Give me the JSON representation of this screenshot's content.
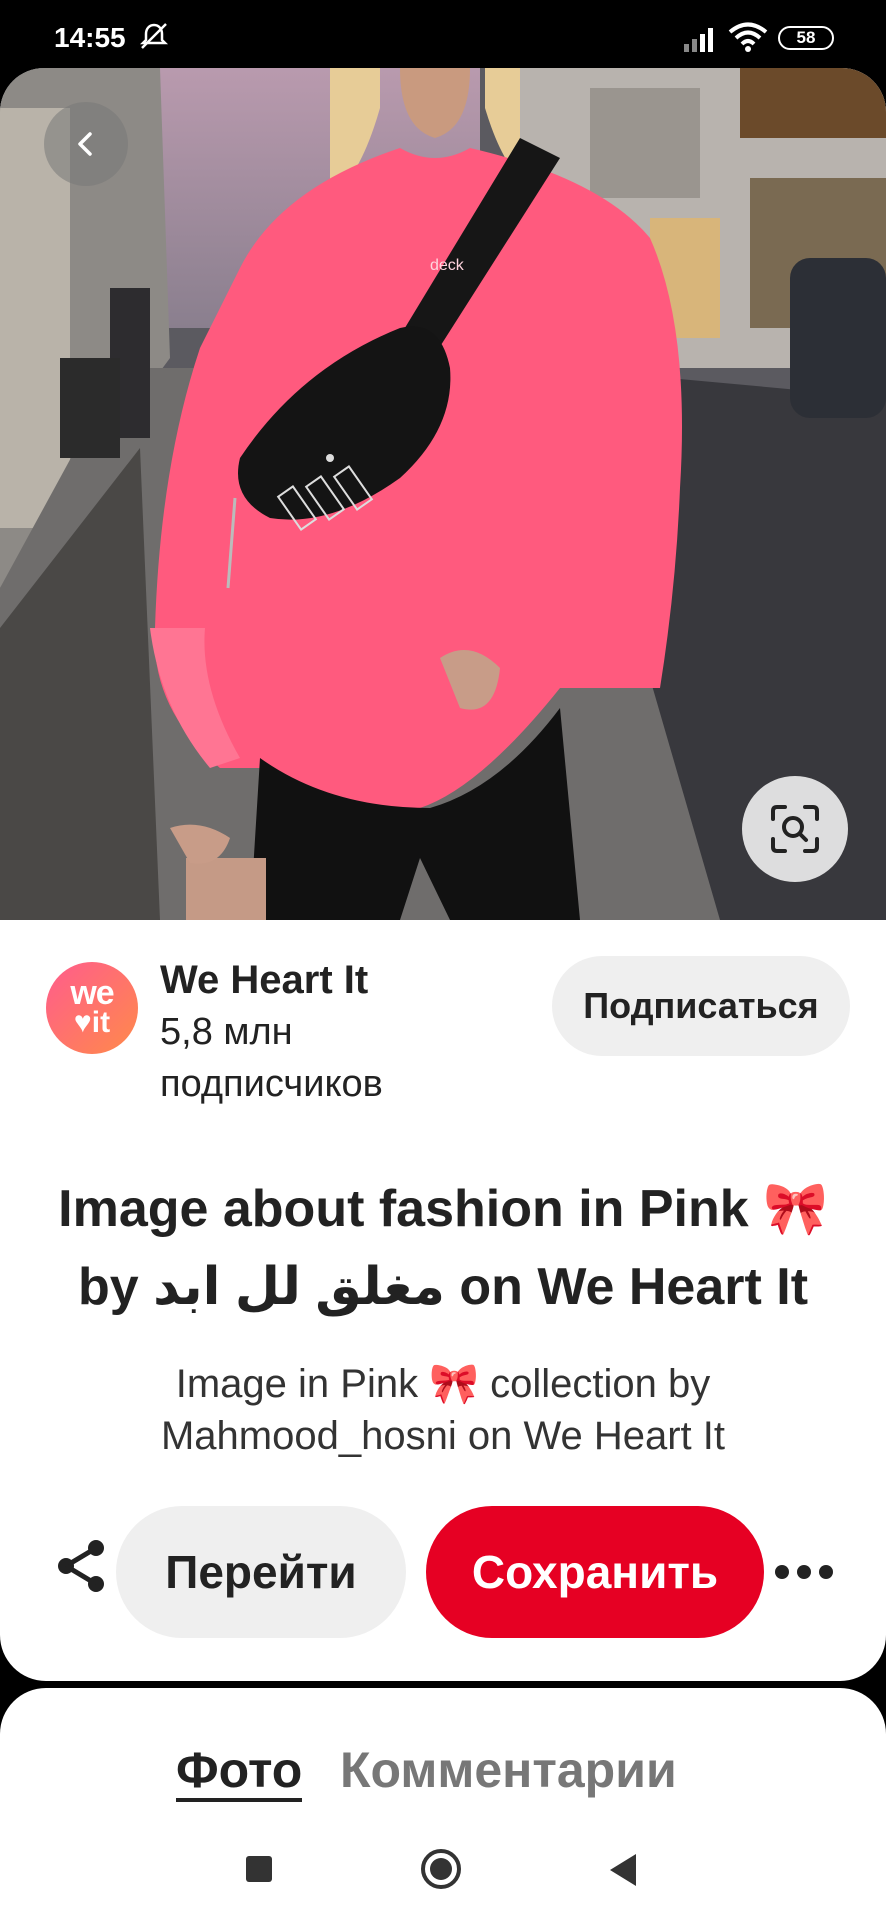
{
  "status_bar": {
    "time": "14:55",
    "battery": "58",
    "icons": [
      "bell-muted-icon",
      "signal-icon",
      "wifi-icon",
      "battery-icon"
    ]
  },
  "photo": {
    "shirt_print": "deck",
    "alt_icons": [
      "back-icon",
      "visual-search-icon"
    ]
  },
  "author": {
    "avatar_line1": "we",
    "avatar_line2": "♥it",
    "name": "We Heart It",
    "subscribers": "5,8 млн подписчиков",
    "follow_label": "Подписаться"
  },
  "pin": {
    "title_line1": "Image about fashion in Pink 🎀",
    "title_line2": "by مغلق لل ابد on We Heart It",
    "description_line1": "Image in Pink 🎀 collection by",
    "description_line2": "Mahmood_hosni on We Heart It"
  },
  "actions": {
    "goto_label": "Перейти",
    "save_label": "Сохранить"
  },
  "tabs": {
    "photo": "Фото",
    "comments": "Комментарии"
  },
  "colors": {
    "save": "#e60023",
    "shirt": "#ff5a7e"
  }
}
